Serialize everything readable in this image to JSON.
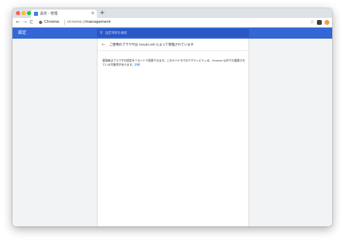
{
  "tab": {
    "title": "設定 - 管理",
    "close_glyph": "×",
    "new_tab_glyph": "+"
  },
  "toolbar": {
    "back_glyph": "←",
    "forward_glyph": "→",
    "reload_glyph": "C",
    "omnibox_icon": "info-icon",
    "omnibox_label": "Chrome",
    "url_scheme": "chrome://",
    "url_host": "management",
    "star_glyph": "☆",
    "menu_glyph": "⋮"
  },
  "settings": {
    "title": "設定",
    "search_placeholder": "設定項目を検索"
  },
  "management": {
    "back_glyph": "←",
    "heading": "ご使用のブラウザは rnsuki.net によって管理されています",
    "description": "管理者はブラウザの設定をリモートで変更できます。このデバイスでのアクティビティは、Chrome 以外でも管理されている可能性があります。",
    "learn_more": "詳細"
  },
  "colors": {
    "header_blue": "#3367d6",
    "search_blue": "#2a56c6",
    "link_blue": "#1a73e8",
    "page_gray": "#f1f3f4"
  }
}
